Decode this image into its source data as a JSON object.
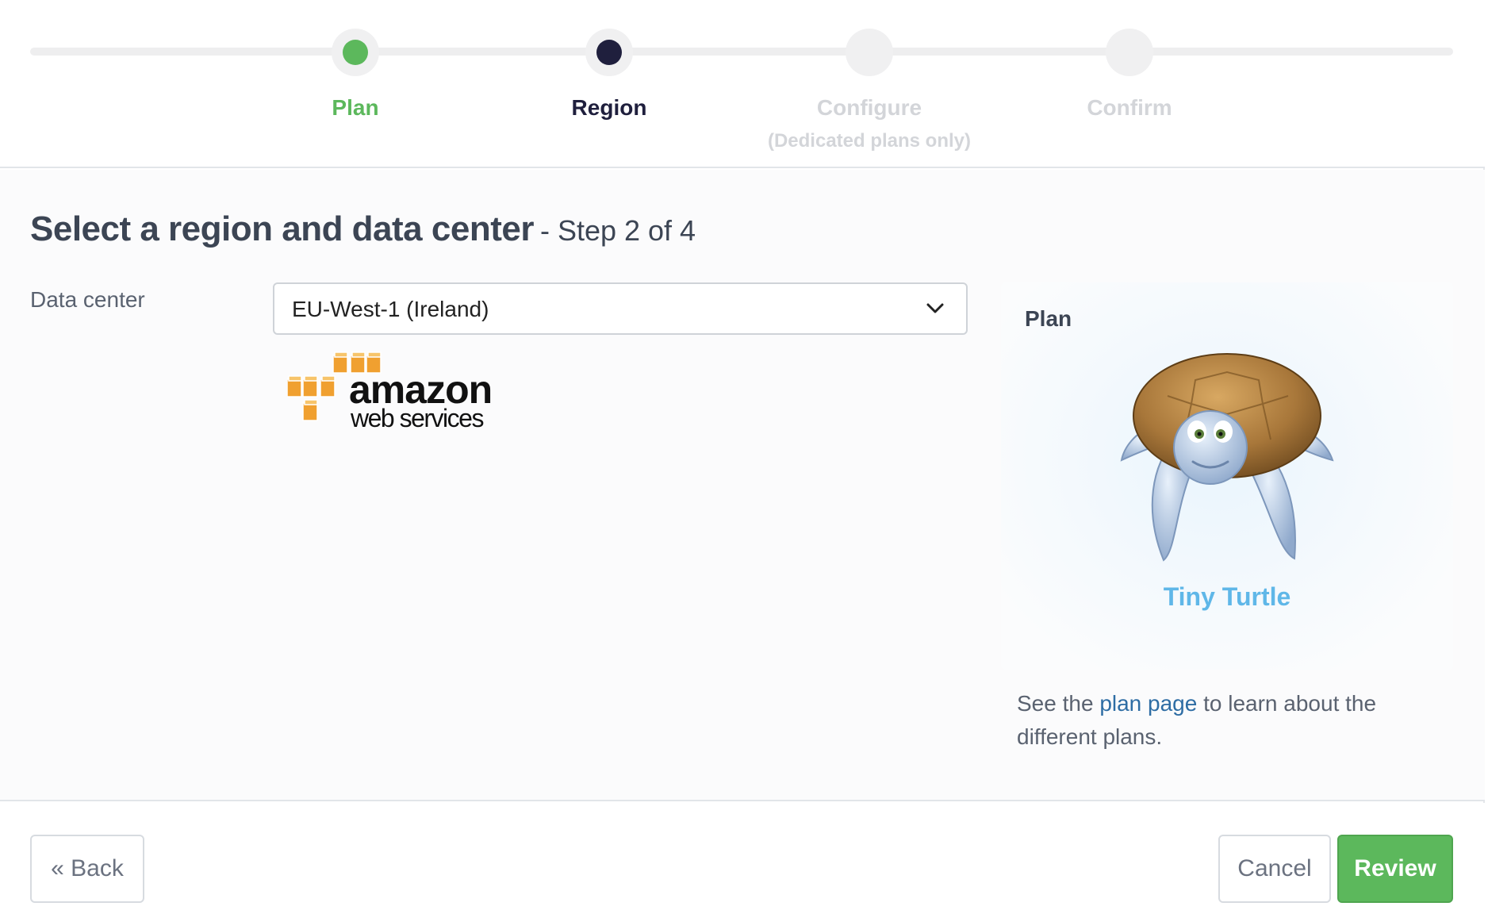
{
  "stepper": {
    "steps": [
      {
        "label": "Plan",
        "sublabel": "",
        "state": "completed"
      },
      {
        "label": "Region",
        "sublabel": "",
        "state": "current"
      },
      {
        "label": "Configure",
        "sublabel": "(Dedicated plans only)",
        "state": "upcoming"
      },
      {
        "label": "Confirm",
        "sublabel": "",
        "state": "upcoming"
      }
    ],
    "colors": {
      "completed": "#5cb85c",
      "current": "#1f1f3d",
      "upcoming": "#d3d5d9"
    }
  },
  "page": {
    "title": "Select a region and data center",
    "subtitle": "- Step 2 of 4"
  },
  "datacenter": {
    "label": "Data center",
    "selected": "EU-West-1 (Ireland)",
    "provider_logo": {
      "line1": "amazon",
      "line2": "web services"
    }
  },
  "plan_card": {
    "heading": "Plan",
    "plan_name": "Tiny Turtle",
    "note_prefix": "See the ",
    "note_link": "plan page",
    "note_suffix": " to learn about the different plans."
  },
  "footer": {
    "back_label": "« Back",
    "cancel_label": "Cancel",
    "review_label": "Review"
  },
  "icons": {
    "select_caret": "chevron-down-icon",
    "plan_mascot": "turtle-icon"
  }
}
